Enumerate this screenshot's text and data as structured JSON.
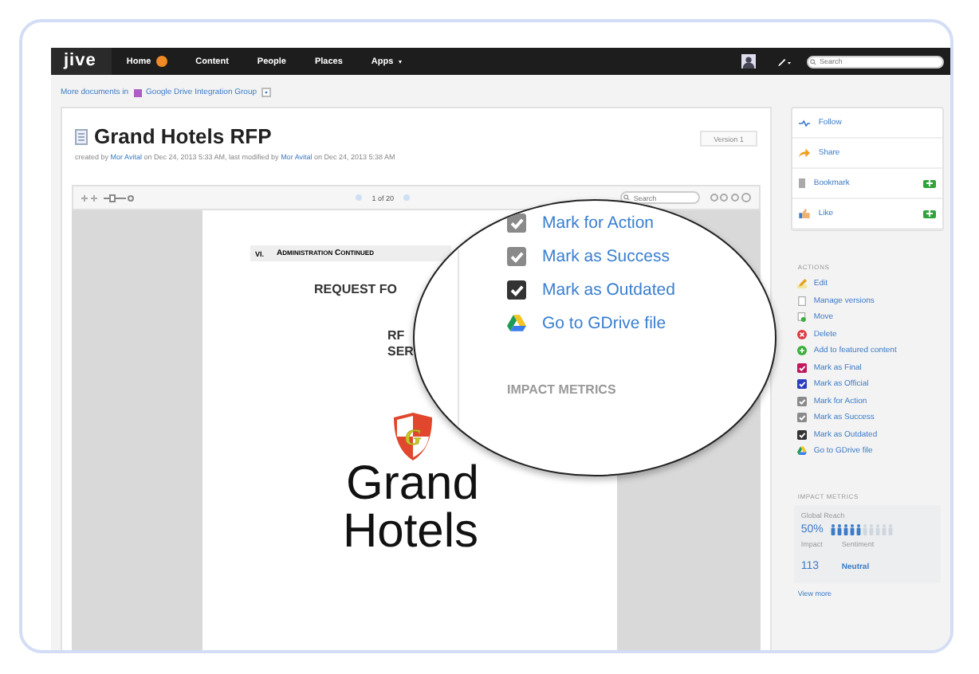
{
  "nav": {
    "logo": "jive",
    "items": [
      {
        "label": "Home",
        "kind": "badge"
      },
      {
        "label": "Content",
        "kind": "plain"
      },
      {
        "label": "People",
        "kind": "plain"
      },
      {
        "label": "Places",
        "kind": "plain"
      },
      {
        "label": "Apps",
        "kind": "menu"
      }
    ],
    "search": {
      "placeholder": "Search"
    }
  },
  "breadcrumb": {
    "prefix": "More documents in",
    "group": "Google Drive Integration Group"
  },
  "document": {
    "title": "Grand Hotels RFP",
    "meta": [
      {
        "kind": "text",
        "text": "created by"
      },
      {
        "kind": "link",
        "text": "Mor Avital"
      },
      {
        "kind": "text",
        "text": "on Dec 24, 2013 5:33 AM, last modified by"
      },
      {
        "kind": "link",
        "text": "Mor Avital"
      },
      {
        "kind": "text",
        "text": "on Dec 24, 2013 5:38 AM"
      }
    ],
    "version": "Version 1"
  },
  "viewer": {
    "page": "1 of 20",
    "search": {
      "placeholder": "Search"
    }
  },
  "page_content": {
    "section": "VI.",
    "section_title": "Administration Continued",
    "lines": [
      "REQUEST FO",
      "RF",
      "SER"
    ],
    "logo_letter": "G",
    "title_lines": [
      "Grand",
      "Hotels"
    ]
  },
  "magnifier": {
    "items": [
      {
        "label": "Mark for Action",
        "kind": "check",
        "color": "#8a8a8a"
      },
      {
        "label": "Mark as Success",
        "kind": "check",
        "color": "#8a8a8a"
      },
      {
        "label": "Mark as Outdated",
        "kind": "check",
        "color": "#333333"
      },
      {
        "label": "Go to GDrive file",
        "kind": "gdrive"
      }
    ],
    "heading": "IMPACT METRICS"
  },
  "sidebar": {
    "social": [
      {
        "label": "Follow",
        "kind": "follow",
        "has_add": false
      },
      {
        "label": "Share",
        "kind": "share",
        "has_add": false
      },
      {
        "label": "Bookmark",
        "kind": "bookmark",
        "has_add": true
      },
      {
        "label": "Like",
        "kind": "like",
        "has_add": true
      }
    ],
    "actions_heading": "ACTIONS",
    "actions": [
      {
        "label": "Edit",
        "kind": "edit"
      },
      {
        "label": "Manage versions",
        "kind": "versions"
      },
      {
        "label": "Move",
        "kind": "move"
      },
      {
        "label": "Delete",
        "kind": "delete"
      },
      {
        "label": "Add to featured content",
        "kind": "add"
      },
      {
        "label": "Mark as Final",
        "kind": "check",
        "color": "#c2185b"
      },
      {
        "label": "Mark as Official",
        "kind": "check",
        "color": "#2a3fc0"
      },
      {
        "label": "Mark for Action",
        "kind": "check",
        "color": "#8a8a8a"
      },
      {
        "label": "Mark as Success",
        "kind": "check",
        "color": "#8a8a8a"
      },
      {
        "label": "Mark as Outdated",
        "kind": "check",
        "color": "#333333"
      },
      {
        "label": "Go to GDrive file",
        "kind": "gdrive"
      }
    ],
    "metrics": {
      "heading": "IMPACT METRICS",
      "reach_label": "Global Reach",
      "reach_value": "50%",
      "level": 0.5,
      "impact_label": "Impact",
      "impact_value": "113",
      "sentiment_label": "Sentiment",
      "sentiment_value": "Neutral"
    },
    "view_more": "View more"
  }
}
